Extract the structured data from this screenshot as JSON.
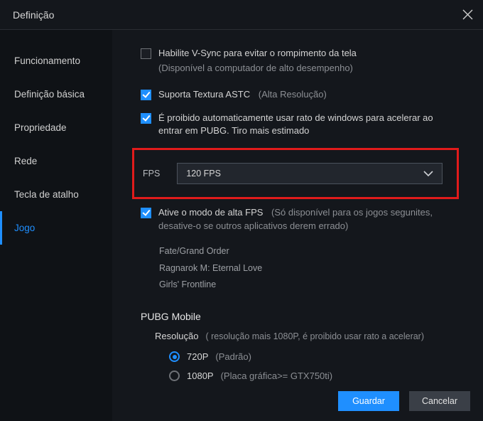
{
  "window": {
    "title": "Definição"
  },
  "sidebar": {
    "items": [
      {
        "label": "Funcionamento"
      },
      {
        "label": "Definição básica"
      },
      {
        "label": "Propriedade"
      },
      {
        "label": "Rede"
      },
      {
        "label": "Tecla de atalho"
      },
      {
        "label": "Jogo"
      }
    ],
    "activeIndex": 5
  },
  "settings": {
    "vsync": {
      "label": "Habilite V-Sync para evitar o rompimento da tela",
      "note": "(Disponível a computador de alto desempenho)",
      "checked": false
    },
    "astc": {
      "label": "Suporta Textura ASTC",
      "note": "(Alta Resolução)",
      "checked": true
    },
    "mouse": {
      "label": "É proibido automaticamente usar rato de windows para acelerar ao entrar em PUBG. Tiro mais estimado",
      "checked": true
    },
    "fps": {
      "label": "FPS",
      "value": "120 FPS"
    },
    "highfps": {
      "label": "Ative o modo de alta FPS",
      "note": "(Só disponível para os jogos segunites, desative-o se outros aplicativos derem errado)",
      "checked": true,
      "games": [
        "Fate/Grand Order",
        "Ragnarok M: Eternal Love",
        "Girls' Frontline"
      ]
    },
    "pubg": {
      "title": "PUBG Mobile",
      "res_label": "Resolução",
      "res_note": "( resolução mais 1080P, é proibido usar rato a acelerar)",
      "options": [
        {
          "label": "720P",
          "sub": "(Padrão)",
          "selected": true
        },
        {
          "label": "1080P",
          "sub": "(Placa gráfica>= GTX750ti)",
          "selected": false
        }
      ]
    }
  },
  "footer": {
    "save": "Guardar",
    "cancel": "Cancelar"
  }
}
